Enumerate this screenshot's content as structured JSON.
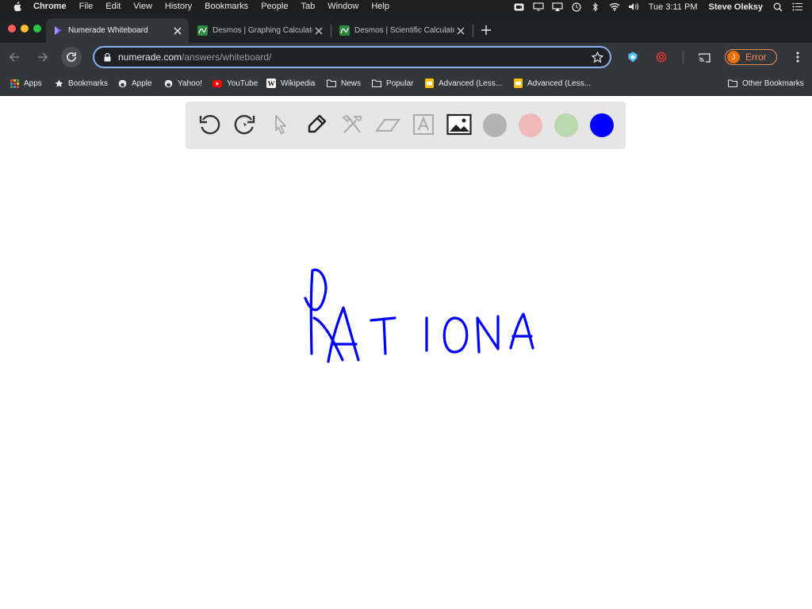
{
  "menubar": {
    "app_name": "Chrome",
    "items": [
      "File",
      "Edit",
      "View",
      "History",
      "Bookmarks",
      "People",
      "Tab",
      "Window",
      "Help"
    ],
    "clock": "Tue 3:11 PM",
    "user": "Steve Oleksy"
  },
  "tabs": [
    {
      "label": "Numerade Whiteboard",
      "active": true,
      "favicon": "numerade-icon"
    },
    {
      "label": "Desmos | Graphing Calculator",
      "active": false,
      "favicon": "desmos-icon"
    },
    {
      "label": "Desmos | Scientific Calculator",
      "active": false,
      "favicon": "desmos-icon"
    }
  ],
  "omnibox": {
    "domain": "numerade.com",
    "path": "/answers/whiteboard/"
  },
  "profile": {
    "initial": "J",
    "status": "Error"
  },
  "bookmarks": {
    "items": [
      "Apps",
      "Bookmarks",
      "Apple",
      "Yahoo!",
      "YouTube",
      "Wikipedia",
      "News",
      "Popular",
      "Advanced (Less...",
      "Advanced (Less..."
    ],
    "other": "Other Bookmarks"
  },
  "whiteboard": {
    "tools": [
      "undo",
      "redo",
      "select",
      "pen",
      "tools",
      "eraser",
      "text",
      "image"
    ],
    "colors": [
      "#b3b3b3",
      "#f0b8b8",
      "#b8d8b0",
      "#0000ff"
    ],
    "selected_color": "#0000ff",
    "handwriting": "RATIONA"
  },
  "colors": {
    "accent": "#8ab4f8",
    "ink": "#0000ff"
  }
}
